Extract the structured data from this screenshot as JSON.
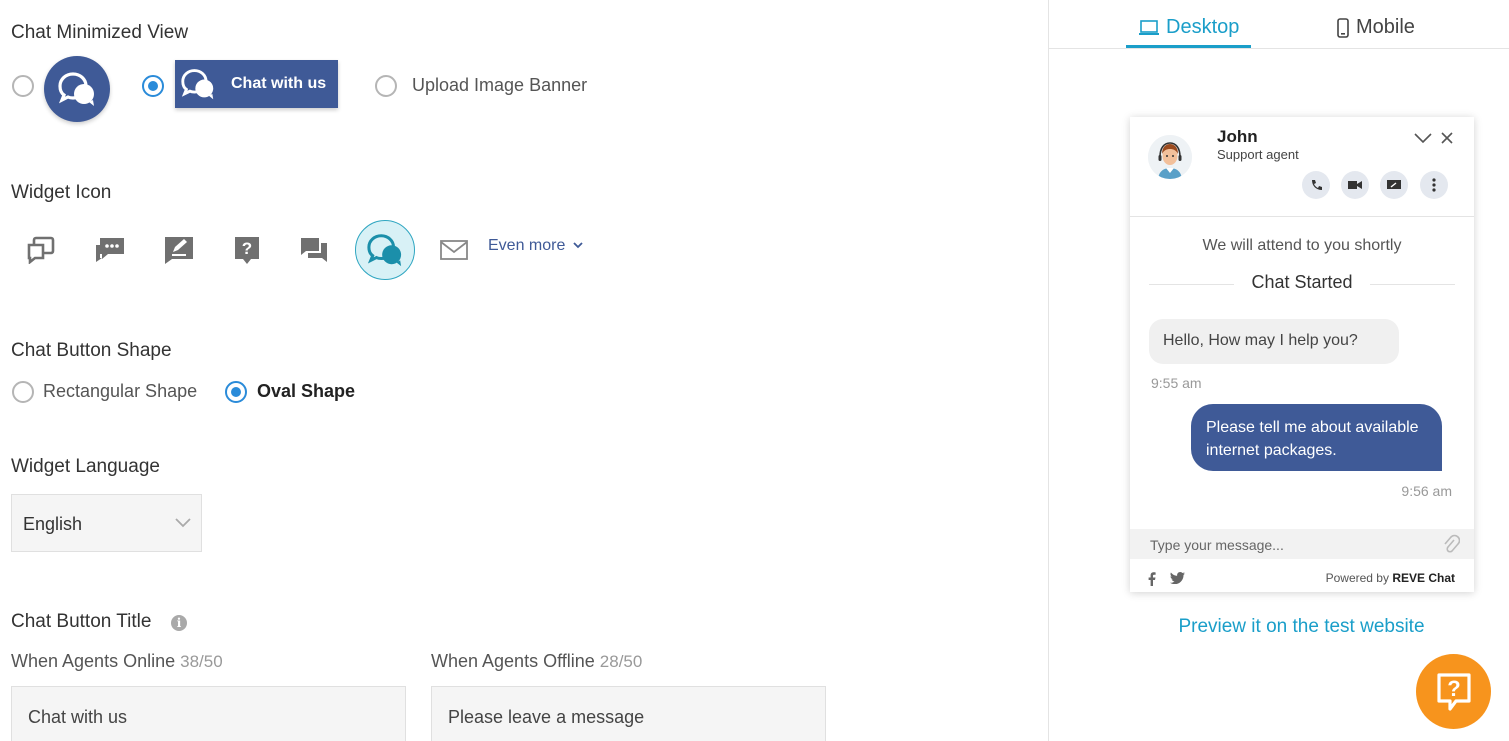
{
  "sections": {
    "minimized_view": {
      "title": "Chat Minimized View",
      "rect_label": "Chat with us",
      "upload_label": "Upload Image Banner"
    },
    "widget_icon": {
      "title": "Widget Icon",
      "even_more": "Even more"
    },
    "button_shape": {
      "title": "Chat Button Shape",
      "rectangular": "Rectangular Shape",
      "oval": "Oval Shape"
    },
    "language": {
      "title": "Widget Language",
      "value": "English"
    },
    "button_title": {
      "title": "Chat Button Title",
      "online_label": "When Agents Online",
      "online_count": "38/50",
      "offline_label": "When Agents Offline",
      "offline_count": "28/50",
      "online_value": "Chat with us",
      "offline_value": "Please leave a message"
    }
  },
  "preview": {
    "tabs": {
      "desktop": "Desktop",
      "mobile": "Mobile"
    },
    "agent": {
      "name": "John",
      "role": "Support agent"
    },
    "messages": {
      "attend": "We will attend to you shortly",
      "started": "Chat Started",
      "incoming": "Hello, How may I help you?",
      "incoming_time": "9:55 am",
      "outgoing": "Please tell me about available internet packages.",
      "outgoing_time": "9:56 am"
    },
    "input_placeholder": "Type your message...",
    "powered_by": "Powered by",
    "brand": "REVE Chat",
    "preview_link": "Preview it on the test website"
  },
  "colors": {
    "primary": "#3f5a97",
    "accent": "#1a9ec9",
    "radio": "#2a8bd9",
    "help": "#f7941d"
  },
  "icons": [
    "chat-bubbles-icon",
    "laptop-icon",
    "mobile-icon",
    "phone-icon",
    "video-icon",
    "screen-share-icon",
    "more-icon",
    "minimize-icon",
    "close-icon",
    "paperclip-icon",
    "facebook-icon",
    "twitter-icon",
    "help-icon",
    "info-icon",
    "chevron-down-icon"
  ]
}
